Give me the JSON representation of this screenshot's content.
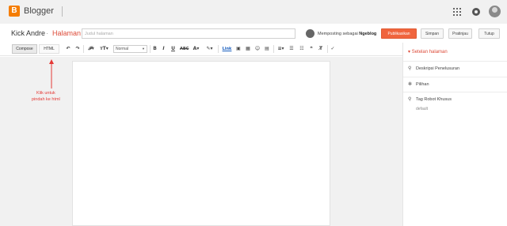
{
  "app": {
    "brand": "Blogger",
    "logo_letter": "B"
  },
  "header": {
    "blog_name": "Kick Andre",
    "separator": "·",
    "page_type": "Halaman",
    "title_placeholder": "Judul halaman",
    "posting_as_prefix": "Memposting sebagai",
    "posting_as_name": "Ngeblog",
    "publish_label": "Publikasikan",
    "save_label": "Simpan",
    "preview_label": "Pratinjau",
    "close_label": "Tutup"
  },
  "toolbar": {
    "compose_label": "Compose",
    "html_label": "HTML",
    "format_value": "Normal",
    "link_label": "Link"
  },
  "annotation": {
    "text": "Klik untuk\npindah ke html"
  },
  "sidebar": {
    "header": "Setelan halaman",
    "items": [
      {
        "label": "Deskripsi Penelusuran",
        "icon": "search-icon"
      },
      {
        "label": "Pilihan",
        "icon": "gear-icon"
      },
      {
        "label": "Tag Robot Khusus",
        "icon": "search-icon"
      }
    ],
    "robot_default": "default"
  },
  "colors": {
    "accent": "#dd4b39",
    "publish": "#f0653e",
    "logo": "#f57d00",
    "annotation": "#e53935"
  }
}
